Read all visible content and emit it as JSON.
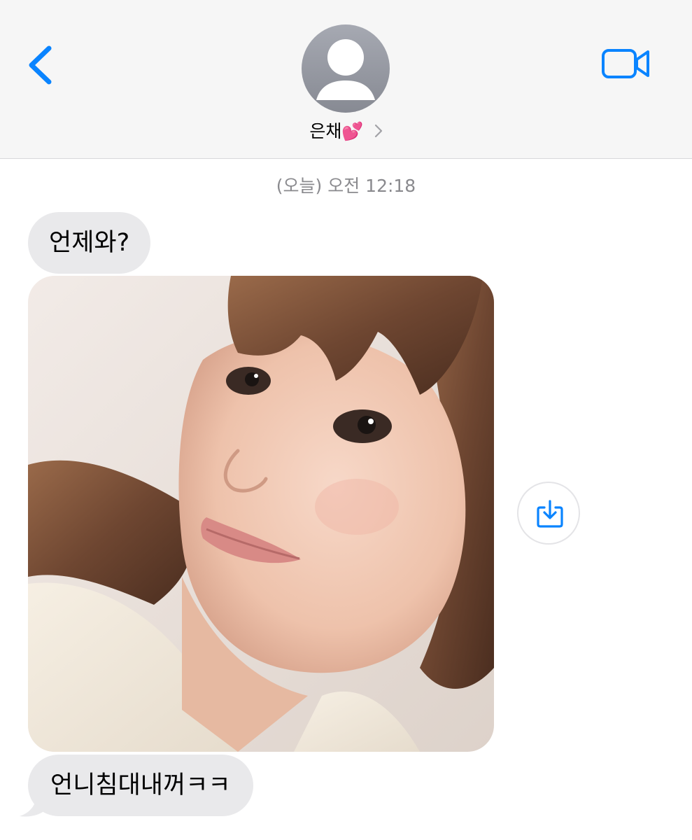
{
  "header": {
    "contact_name": "은채💕",
    "back_icon": "chevron-left-icon",
    "video_icon": "video-camera-icon",
    "avatar_icon": "person-silhouette-icon",
    "accent_color": "#0a84ff"
  },
  "conversation": {
    "timestamp": "(오늘) 오전 12:18",
    "messages": [
      {
        "type": "text",
        "text": "언제와?"
      },
      {
        "type": "image",
        "description_icon": "photo"
      },
      {
        "type": "text",
        "text": "언니침대내꺼ㅋㅋ"
      }
    ],
    "save_icon": "save-to-photos-icon"
  },
  "colors": {
    "received_bubble": "#e9e9eb",
    "header_background": "#f6f6f6",
    "timestamp_text": "#8a8a8e"
  }
}
